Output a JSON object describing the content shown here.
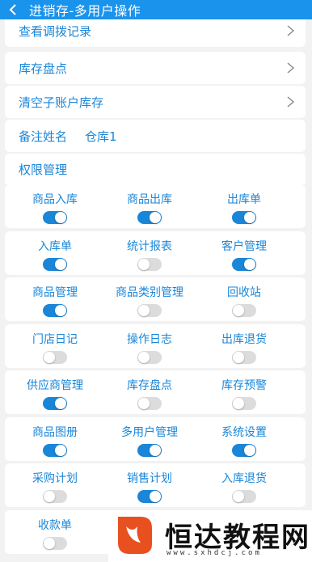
{
  "header": {
    "title": "进销存-多用户操作"
  },
  "menu": [
    {
      "label": "查看调拨记录"
    },
    {
      "label": "库存盘点"
    },
    {
      "label": "清空子账户库存"
    }
  ],
  "remark": {
    "label": "备注姓名",
    "value": "仓库1"
  },
  "permissions": {
    "title": "权限管理",
    "items": [
      {
        "label": "商品入库",
        "on": true
      },
      {
        "label": "商品出库",
        "on": true
      },
      {
        "label": "出库单",
        "on": true
      },
      {
        "label": "入库单",
        "on": true
      },
      {
        "label": "统计报表",
        "on": false
      },
      {
        "label": "客户管理",
        "on": true
      },
      {
        "label": "商品管理",
        "on": true
      },
      {
        "label": "商品类别管理",
        "on": false
      },
      {
        "label": "回收站",
        "on": false
      },
      {
        "label": "门店日记",
        "on": false
      },
      {
        "label": "操作日志",
        "on": false
      },
      {
        "label": "出库退货",
        "on": false
      },
      {
        "label": "供应商管理",
        "on": true
      },
      {
        "label": "库存盘点",
        "on": false
      },
      {
        "label": "库存预警",
        "on": false
      },
      {
        "label": "商品图册",
        "on": true
      },
      {
        "label": "多用户管理",
        "on": true
      },
      {
        "label": "系统设置",
        "on": true
      },
      {
        "label": "采购计划",
        "on": false
      },
      {
        "label": "销售计划",
        "on": true
      },
      {
        "label": "入库退货",
        "on": false
      },
      {
        "label": "收款单",
        "on": false
      }
    ]
  },
  "watermark": {
    "text": "恒达教程网",
    "url": "www.sxhdcj.com"
  },
  "colors": {
    "accent": "#1a86d8",
    "header": "#1a93ec"
  }
}
